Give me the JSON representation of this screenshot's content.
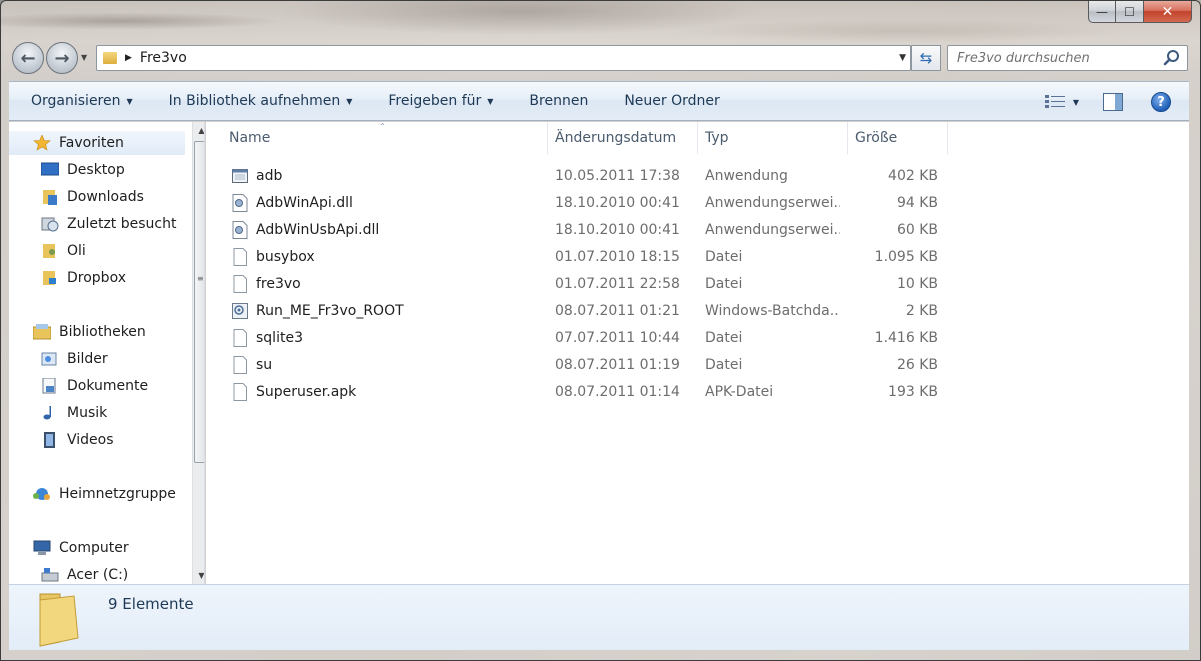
{
  "window": {
    "caption": {
      "minimize": "—",
      "maximize": "☐",
      "close": "✕"
    }
  },
  "address": {
    "path": "Fre3vo"
  },
  "search": {
    "placeholder": "Fre3vo durchsuchen"
  },
  "toolbar": {
    "items": [
      {
        "label": "Organisieren",
        "has_dropdown": true
      },
      {
        "label": "In Bibliothek aufnehmen",
        "has_dropdown": true
      },
      {
        "label": "Freigeben für",
        "has_dropdown": true
      },
      {
        "label": "Brennen",
        "has_dropdown": false
      },
      {
        "label": "Neuer Ordner",
        "has_dropdown": false
      }
    ],
    "help": "?"
  },
  "sidebar": {
    "items": [
      {
        "label": "Favoriten",
        "icon": "star-icon",
        "level": 0,
        "selected": true
      },
      {
        "label": "Desktop",
        "icon": "desktop-icon",
        "level": 1
      },
      {
        "label": "Downloads",
        "icon": "downloads-folder-icon",
        "level": 1
      },
      {
        "label": "Zuletzt besucht",
        "icon": "recent-places-icon",
        "level": 1
      },
      {
        "label": "Oli",
        "icon": "user-folder-icon",
        "level": 1
      },
      {
        "label": "Dropbox",
        "icon": "dropbox-folder-icon",
        "level": 1
      },
      {
        "label": "Bibliotheken",
        "icon": "libraries-icon",
        "level": 0
      },
      {
        "label": "Bilder",
        "icon": "pictures-icon",
        "level": 1
      },
      {
        "label": "Dokumente",
        "icon": "documents-icon",
        "level": 1
      },
      {
        "label": "Musik",
        "icon": "music-icon",
        "level": 1
      },
      {
        "label": "Videos",
        "icon": "videos-icon",
        "level": 1
      },
      {
        "label": "Heimnetzgruppe",
        "icon": "homegroup-icon",
        "level": 0
      },
      {
        "label": "Computer",
        "icon": "computer-icon",
        "level": 0
      },
      {
        "label": "Acer (C:)",
        "icon": "drive-icon",
        "level": 1
      }
    ]
  },
  "file_list": {
    "columns": [
      "Name",
      "Änderungsdatum",
      "Typ",
      "Größe"
    ],
    "rows": [
      {
        "name": "adb",
        "date": "10.05.2011 17:38",
        "type": "Anwendung",
        "size": "402 KB",
        "icon": "application-icon"
      },
      {
        "name": "AdbWinApi.dll",
        "date": "18.10.2010 00:41",
        "type": "Anwendungserwei...",
        "size": "94 KB",
        "icon": "dll-icon"
      },
      {
        "name": "AdbWinUsbApi.dll",
        "date": "18.10.2010 00:41",
        "type": "Anwendungserwei...",
        "size": "60 KB",
        "icon": "dll-icon"
      },
      {
        "name": "busybox",
        "date": "01.07.2010 18:15",
        "type": "Datei",
        "size": "1.095 KB",
        "icon": "file-icon"
      },
      {
        "name": "fre3vo",
        "date": "01.07.2011 22:58",
        "type": "Datei",
        "size": "10 KB",
        "icon": "file-icon"
      },
      {
        "name": "Run_ME_Fr3vo_ROOT",
        "date": "08.07.2011 01:21",
        "type": "Windows-Batchda...",
        "size": "2 KB",
        "icon": "batch-file-icon"
      },
      {
        "name": "sqlite3",
        "date": "07.07.2011 10:44",
        "type": "Datei",
        "size": "1.416 KB",
        "icon": "file-icon"
      },
      {
        "name": "su",
        "date": "08.07.2011 01:19",
        "type": "Datei",
        "size": "26 KB",
        "icon": "file-icon"
      },
      {
        "name": "Superuser.apk",
        "date": "08.07.2011 01:14",
        "type": "APK-Datei",
        "size": "193 KB",
        "icon": "file-icon"
      }
    ]
  },
  "status": {
    "item_count": "9 Elemente"
  },
  "colors": {
    "command_text": "#1e3956",
    "secondary_text": "#6d6d6d",
    "header_text": "#4b5b6e"
  }
}
